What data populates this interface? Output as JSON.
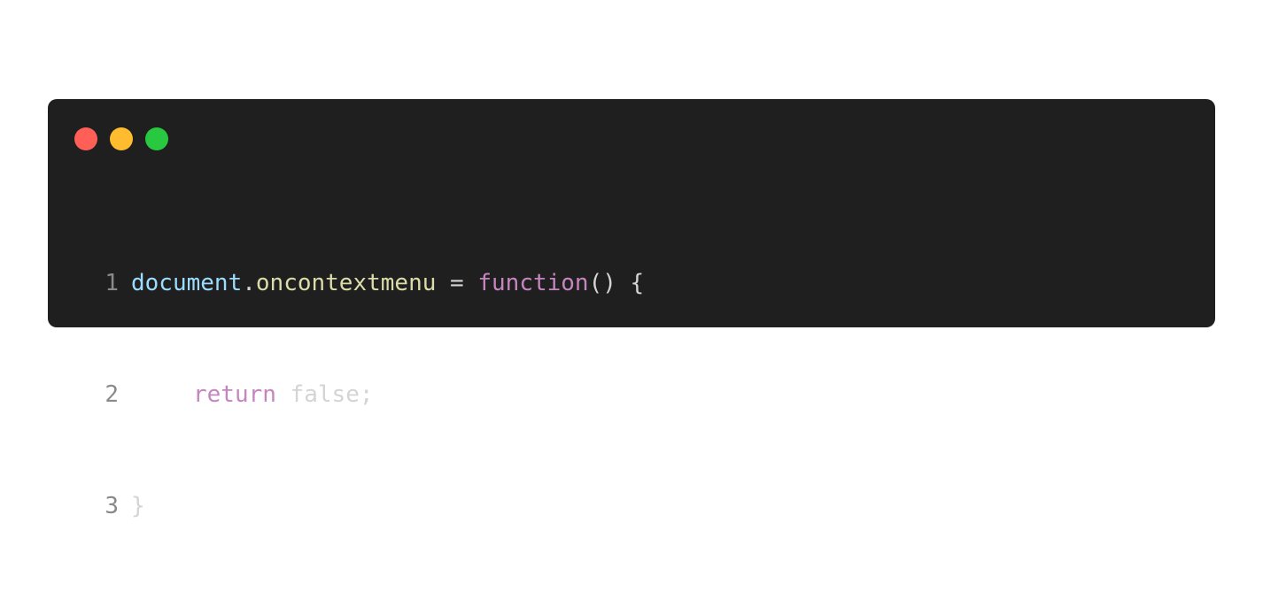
{
  "window": {
    "controls": {
      "close_color": "#ff5f57",
      "minimize_color": "#febc2e",
      "maximize_color": "#28c840"
    }
  },
  "code": {
    "colors": {
      "line_number": "#8a8a8a",
      "identifier": "#9cdcfe",
      "property": "#dcdcaa",
      "keyword": "#c586c0",
      "plain": "#d4d4d4"
    },
    "lines": [
      {
        "number": "1",
        "tokens": [
          {
            "text": "document",
            "kind": "identifier"
          },
          {
            "text": ".",
            "kind": "plain"
          },
          {
            "text": "oncontextmenu",
            "kind": "property"
          },
          {
            "text": " = ",
            "kind": "plain"
          },
          {
            "text": "function",
            "kind": "keyword"
          },
          {
            "text": "() {",
            "kind": "plain"
          }
        ]
      },
      {
        "number": "2",
        "tokens": [
          {
            "text": "return",
            "kind": "keyword"
          },
          {
            "text": " false;",
            "kind": "plain"
          }
        ]
      },
      {
        "number": "3",
        "tokens": [
          {
            "text": "}",
            "kind": "plain"
          }
        ]
      }
    ]
  }
}
